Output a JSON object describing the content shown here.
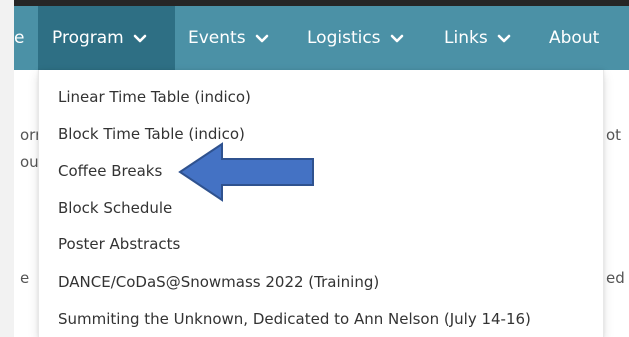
{
  "navbar": {
    "partial_left": "e",
    "items": [
      {
        "label": "Program",
        "active": true
      },
      {
        "label": "Events",
        "active": false
      },
      {
        "label": "Logistics",
        "active": false
      },
      {
        "label": "Links",
        "active": false
      },
      {
        "label": "About",
        "active": false
      }
    ]
  },
  "background_text": {
    "left_line1": "orr",
    "left_line2": "ous",
    "left_line3": "e",
    "right_line1": "ot",
    "right_line2": "ed"
  },
  "dropdown": {
    "items": [
      "Linear Time Table (indico)",
      "Block Time Table (indico)",
      "Coffee Breaks",
      "Block Schedule",
      "Poster Abstracts",
      "DANCE/CoDaS@Snowmass 2022 (Training)",
      "Summiting the Unknown, Dedicated to Ann Nelson (July 14-16)"
    ]
  },
  "colors": {
    "navbar": "#4b91a6",
    "navbar_active": "#2e6f84",
    "arrow_fill": "#4472c4",
    "arrow_stroke": "#2f528f"
  }
}
